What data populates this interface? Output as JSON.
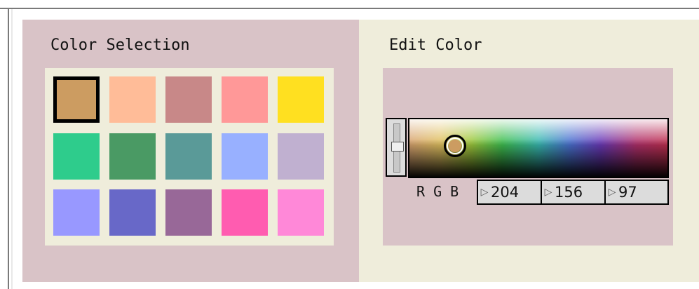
{
  "colorSelection": {
    "title": "Color Selection",
    "selected_index": 0,
    "swatches": [
      {
        "color": "#cc9c61"
      },
      {
        "color": "#ffbc98"
      },
      {
        "color": "#c88888"
      },
      {
        "color": "#ff9898"
      },
      {
        "color": "#ffe020"
      },
      {
        "color": "#2ecc8c"
      },
      {
        "color": "#4a9a64"
      },
      {
        "color": "#5a9a98"
      },
      {
        "color": "#98b0ff"
      },
      {
        "color": "#c0b0d0"
      },
      {
        "color": "#9898ff"
      },
      {
        "color": "#6868c8"
      },
      {
        "color": "#986898"
      },
      {
        "color": "#ff5cb0"
      },
      {
        "color": "#ff88d8"
      }
    ]
  },
  "editColor": {
    "title": "Edit Color",
    "current_color": "#cc9c61",
    "rgb_label": "R G B",
    "r": "204",
    "g": "156",
    "b": "97"
  }
}
